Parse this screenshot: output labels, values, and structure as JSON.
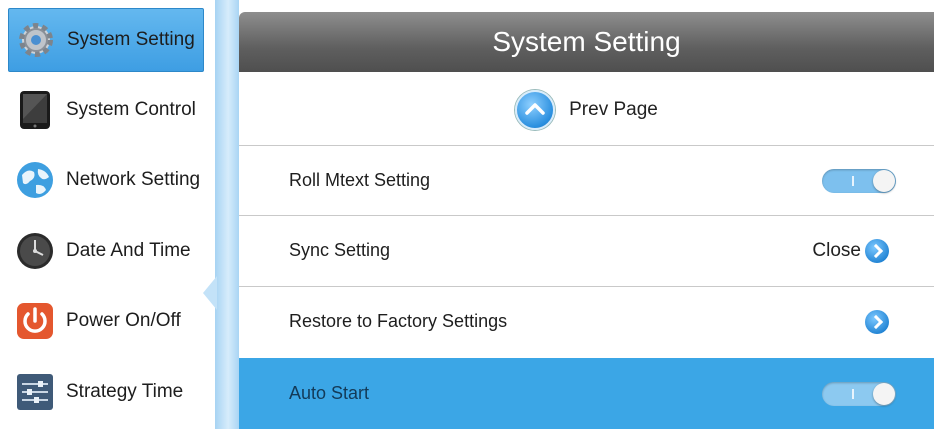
{
  "sidebar": {
    "items": [
      {
        "label": "System Setting",
        "icon": "gear-icon",
        "active": true
      },
      {
        "label": "System Control",
        "icon": "tablet-icon",
        "active": false
      },
      {
        "label": "Network Setting",
        "icon": "globe-icon",
        "active": false
      },
      {
        "label": "Date And Time",
        "icon": "clock-icon",
        "active": false
      },
      {
        "label": "Power On/Off",
        "icon": "power-icon",
        "active": false
      },
      {
        "label": "Strategy Time",
        "icon": "sliders-icon",
        "active": false
      }
    ]
  },
  "header": {
    "title": "System Setting"
  },
  "prev_page": {
    "label": "Prev Page",
    "icon": "chevron-up-icon"
  },
  "rows": [
    {
      "label": "Roll Mtext Setting",
      "control": "toggle",
      "toggle_on": true
    },
    {
      "label": "Sync Setting",
      "control": "value",
      "value": "Close",
      "icon": "chevron-right-icon"
    },
    {
      "label": "Restore to Factory Settings",
      "control": "arrow",
      "icon": "chevron-right-icon"
    },
    {
      "label": "Auto Start",
      "control": "toggle",
      "toggle_on": true,
      "highlighted": true
    }
  ],
  "colors": {
    "accent": "#3ba6e6",
    "header": "#5f5f5f",
    "active_sidebar": "#4aa8ea"
  }
}
